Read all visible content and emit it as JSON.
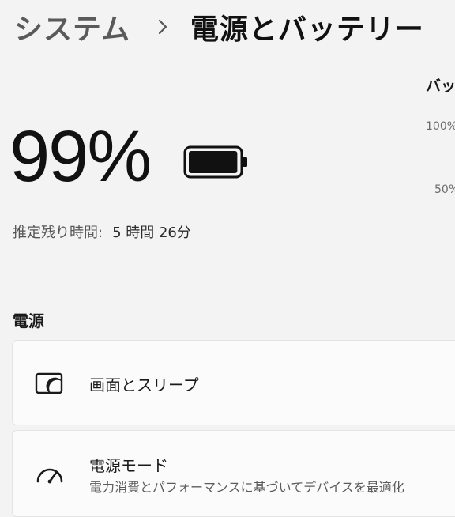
{
  "header": {
    "breadcrumb_parent": "システム",
    "breadcrumb_separator_icon": "chevron-right-icon",
    "page_title": "電源とバッテリー"
  },
  "battery": {
    "percent_text": "99%",
    "level_percent": 99,
    "icon": "battery-full-icon",
    "remaining_label": "推定残り時間:",
    "remaining_value": "5 時間 26分"
  },
  "usage_chart": {
    "title": "バッ",
    "tick_100": "100%",
    "tick_50": "50%"
  },
  "power_section": {
    "title": "電源",
    "items": [
      {
        "icon": "screen-sleep-icon",
        "title": "画面とスリープ"
      },
      {
        "icon": "gauge-icon",
        "title": "電源モード",
        "description": "電力消費とパフォーマンスに基づいてデバイスを最適化"
      }
    ]
  }
}
